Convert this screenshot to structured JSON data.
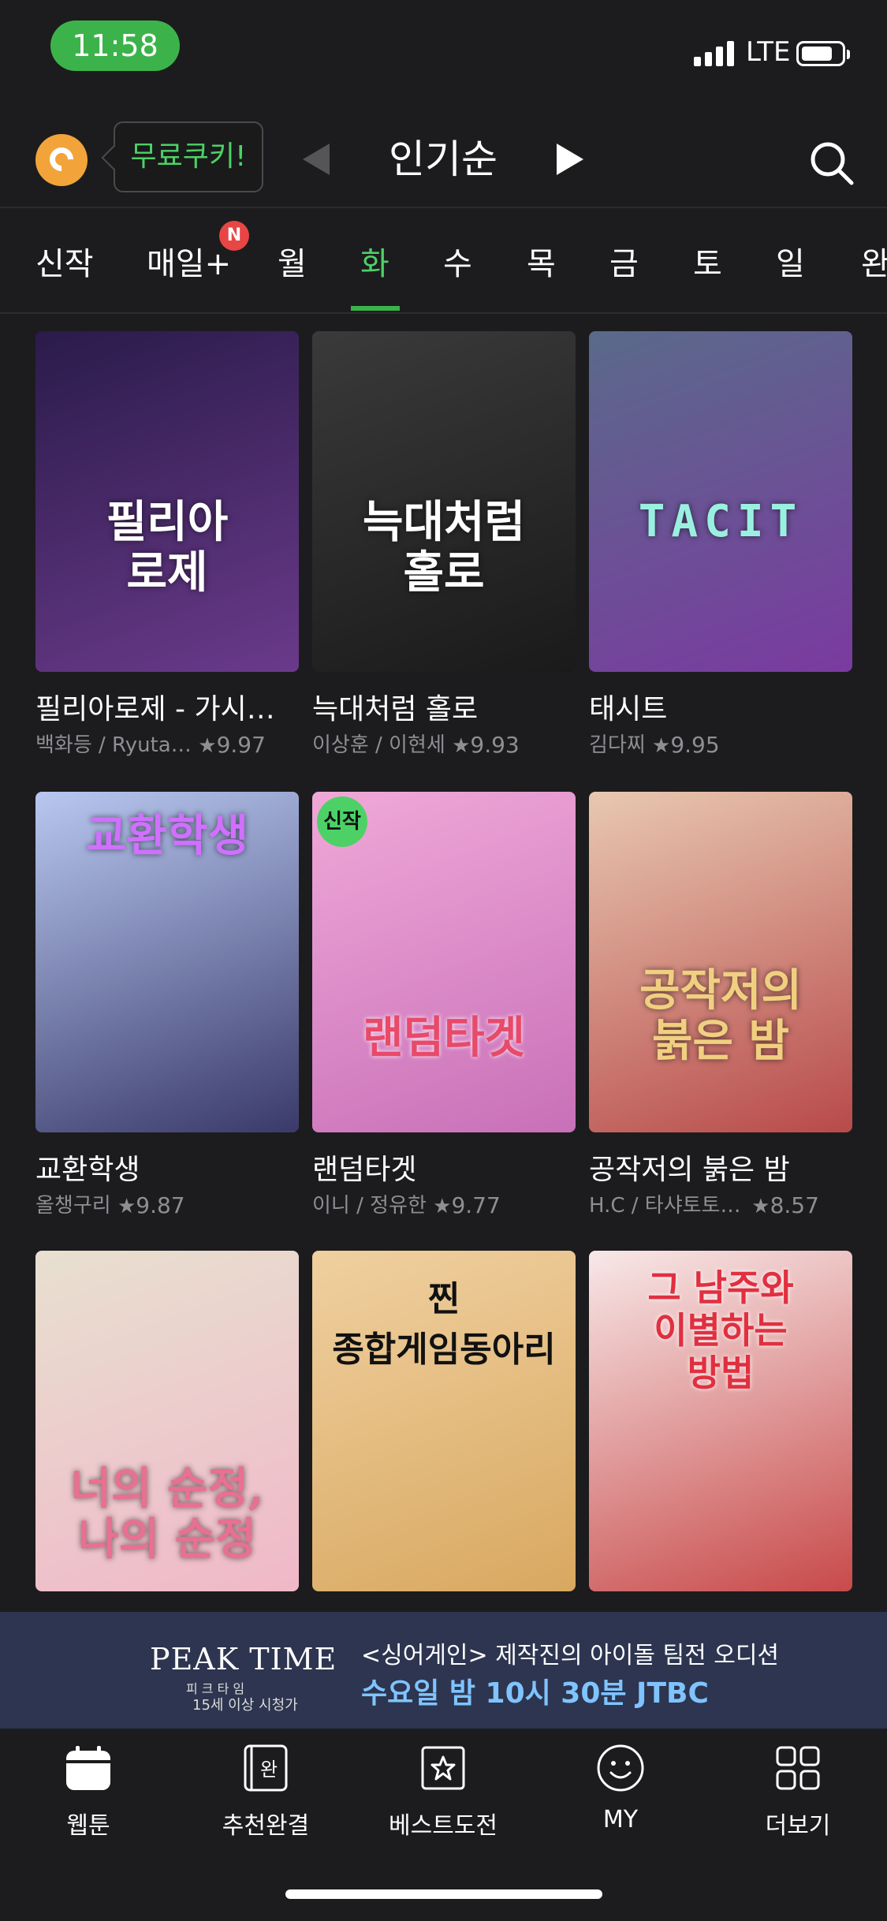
{
  "status": {
    "time": "11:58",
    "carrier": "LTE"
  },
  "header": {
    "free_cookie": "무료쿠키!",
    "sort": "인기순"
  },
  "tabs": [
    {
      "label": "신작"
    },
    {
      "label": "매일+",
      "badge": "N"
    },
    {
      "label": "월"
    },
    {
      "label": "화",
      "active": true
    },
    {
      "label": "수"
    },
    {
      "label": "목"
    },
    {
      "label": "금"
    },
    {
      "label": "토"
    },
    {
      "label": "일"
    },
    {
      "label": "완"
    }
  ],
  "badge_new_label": "신작",
  "comics": [
    {
      "title": "필리아로제 - 가시왕관의 예언",
      "cover_text": "필리아\n로제",
      "author": "백화등 / Ryuta / 김…",
      "rating": "9.97",
      "colors": [
        "#2a1b4a",
        "#6a3a8a"
      ]
    },
    {
      "title": "늑대처럼 홀로",
      "cover_text": "늑대처럼\n홀로",
      "author": "이상훈 / 이현세",
      "rating": "9.93",
      "colors": [
        "#3a3a3a",
        "#1a1a1a"
      ]
    },
    {
      "title": "태시트",
      "cover_text": "TACIT",
      "author": "김다찌",
      "rating": "9.95",
      "colors": [
        "#5a6a8a",
        "#7a3aa0"
      ]
    },
    {
      "title": "교환학생",
      "cover_text": "교환학생",
      "author": "올챙구리",
      "rating": "9.87",
      "colors": [
        "#b8c8f0",
        "#3a3a6a"
      ]
    },
    {
      "title": "랜덤타겟",
      "cover_text": "랜덤타겟",
      "author": "이니 / 정유한",
      "rating": "9.77",
      "colors": [
        "#f0a8d8",
        "#c870b8"
      ],
      "is_new": true
    },
    {
      "title": "공작저의 붉은 밤",
      "cover_text": "공작저의\n붉은 밤",
      "author": "H.C / 타샤토토 / 유…",
      "rating": "8.57",
      "colors": [
        "#e8c8b0",
        "#b84a4a"
      ]
    },
    {
      "title": "너의 순정, 나의 순정",
      "cover_text": "너의 순정,\n나의 순정",
      "author": "",
      "rating": "",
      "colors": [
        "#e8e0d0",
        "#f0b8c8"
      ]
    },
    {
      "title": "찐 종합게임동아리",
      "cover_text": "찐\n종합게임동아리",
      "author": "",
      "rating": "",
      "colors": [
        "#f0d0a0",
        "#d8a860"
      ]
    },
    {
      "title": "그 남주와 이별하는 방법",
      "cover_text": "그 남주와\n이별하는\n방법",
      "author": "",
      "rating": "",
      "colors": [
        "#f8e8e8",
        "#c84a4a"
      ]
    }
  ],
  "banner": {
    "logo": "PEAK TIME",
    "logo_sub": "피 크 타 임",
    "age_rating": "15세 이상 시청가",
    "line1": "<싱어게인> 제작진의 아이돌 팀전 오디션",
    "line2": "수요일 밤 10시 30분 JTBC"
  },
  "nav": [
    {
      "label": "웹툰",
      "icon": "calendar-icon"
    },
    {
      "label": "추천완결",
      "icon": "book-icon",
      "glyph": "완"
    },
    {
      "label": "베스트도전",
      "icon": "star-badge-icon"
    },
    {
      "label": "MY",
      "icon": "smiley-icon"
    },
    {
      "label": "더보기",
      "icon": "grid-icon"
    }
  ]
}
